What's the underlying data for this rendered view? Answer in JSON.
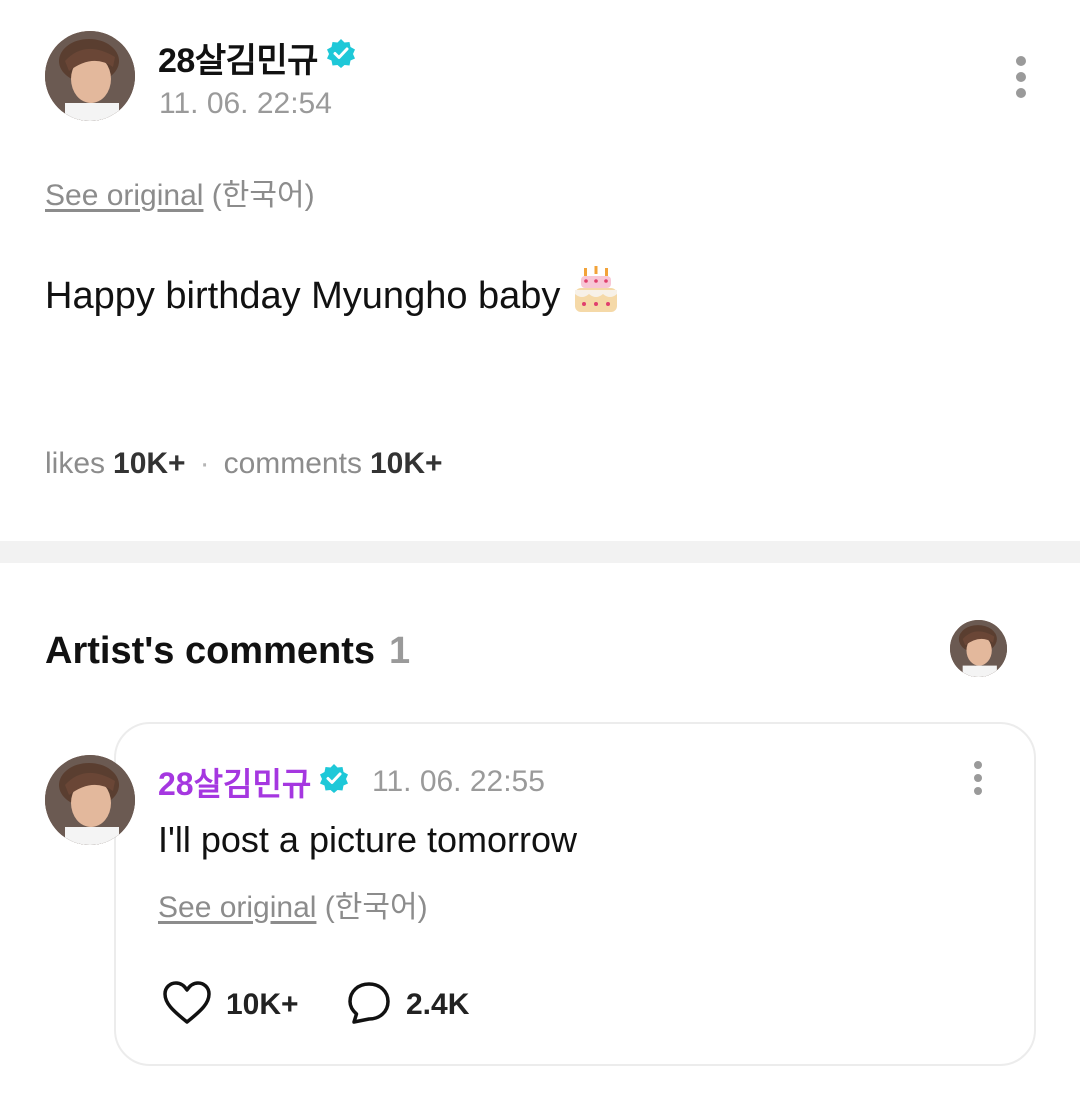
{
  "post": {
    "author": "28살김민규",
    "timestamp": "11. 06. 22:54",
    "see_original": "See original",
    "language": "(한국어)",
    "body": "Happy birthday Myungho baby",
    "body_emoji": "cake-icon",
    "likes_label": "likes",
    "likes_value": "10K+",
    "separator": "·",
    "comments_label": "comments",
    "comments_value": "10K+"
  },
  "artist_comments": {
    "title": "Artist's comments",
    "count": "1",
    "items": [
      {
        "author": "28살김민규",
        "timestamp": "11. 06. 22:55",
        "text": "I'll post a picture tomorrow",
        "see_original": "See original",
        "language": "(한국어)",
        "likes": "10K+",
        "replies": "2.4K"
      }
    ]
  },
  "colors": {
    "verified_badge": "#1ec8d8",
    "artist_name": "#a537e0",
    "muted_text": "#9a9a9a",
    "divider": "#f2f2f2"
  }
}
